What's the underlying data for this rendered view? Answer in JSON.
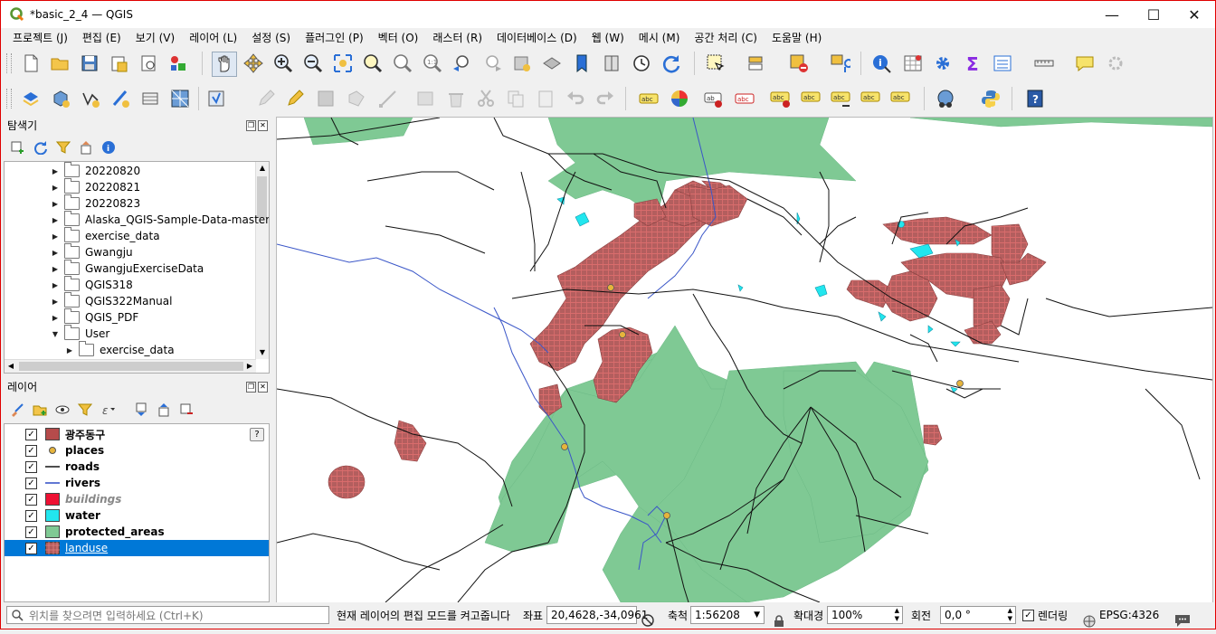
{
  "window": {
    "title": "*basic_2_4 — QGIS",
    "controls": {
      "minimize": "—",
      "maximize": "☐",
      "close": "✕"
    }
  },
  "menu": [
    "프로젝트 (J)",
    "편집 (E)",
    "보기 (V)",
    "레이어 (L)",
    "설정 (S)",
    "플러그인 (P)",
    "벡터 (O)",
    "래스터 (R)",
    "데이터베이스 (D)",
    "웹 (W)",
    "메시 (M)",
    "공간 처리 (C)",
    "도움말 (H)"
  ],
  "browser_panel": {
    "title": "탐색기",
    "items": [
      {
        "label": "20220820",
        "indent": 0,
        "expanded": false
      },
      {
        "label": "20220821",
        "indent": 0,
        "expanded": false
      },
      {
        "label": "20220823",
        "indent": 0,
        "expanded": false
      },
      {
        "label": "Alaska_QGIS-Sample-Data-master",
        "indent": 0,
        "expanded": false
      },
      {
        "label": "exercise_data",
        "indent": 0,
        "expanded": false
      },
      {
        "label": "Gwangju",
        "indent": 0,
        "expanded": false
      },
      {
        "label": "GwangjuExerciseData",
        "indent": 0,
        "expanded": false
      },
      {
        "label": "QGIS318",
        "indent": 0,
        "expanded": false
      },
      {
        "label": "QGIS322Manual",
        "indent": 0,
        "expanded": false
      },
      {
        "label": "QGIS_PDF",
        "indent": 0,
        "expanded": false
      },
      {
        "label": "User",
        "indent": 0,
        "expanded": true
      },
      {
        "label": "exercise_data",
        "indent": 1,
        "expanded": false
      }
    ]
  },
  "layers_panel": {
    "title": "레이어",
    "help_badge": "?",
    "layers": [
      {
        "name": "광주동구",
        "symbol": "fill",
        "color": "#b54b4b",
        "checked": true,
        "style": "normal"
      },
      {
        "name": "places",
        "symbol": "point",
        "color": "#e6b43c",
        "checked": true,
        "style": "normal"
      },
      {
        "name": "roads",
        "symbol": "line",
        "color": "#222222",
        "checked": true,
        "style": "normal"
      },
      {
        "name": "rivers",
        "symbol": "line",
        "color": "#3a56c8",
        "checked": true,
        "style": "normal"
      },
      {
        "name": "buildings",
        "symbol": "fill",
        "color": "#ee1133",
        "checked": true,
        "style": "disabled"
      },
      {
        "name": "water",
        "symbol": "fill",
        "color": "#22e6ee",
        "checked": true,
        "style": "normal"
      },
      {
        "name": "protected_areas",
        "symbol": "fill",
        "color": "#7fc994",
        "checked": true,
        "style": "normal"
      },
      {
        "name": "landuse",
        "symbol": "hatch",
        "color": "#b05a5a",
        "checked": true,
        "style": "selected"
      }
    ]
  },
  "map_colors": {
    "protected": "#7fc994",
    "landuse": "#b35e5e",
    "hatch": "#d96c6c",
    "water": "#22e6ee",
    "roads": "#111111",
    "rivers": "#3a56c8",
    "places": "#e6b43c"
  },
  "statusbar": {
    "locator_placeholder": "위치를 찾으려면 입력하세요 (Ctrl+K)",
    "message": "현재 레이어의 편집 모드를 켜고줍니다",
    "coord_label": "좌표",
    "coord_value": "20,4628,-34,0961",
    "scale_label": "축척",
    "scale_value": "1:56208",
    "magnifier_label": "확대경",
    "magnifier_value": "100%",
    "rotation_label": "회전",
    "rotation_value": "0,0 °",
    "render_label": "렌더링",
    "crs": "EPSG:4326"
  }
}
